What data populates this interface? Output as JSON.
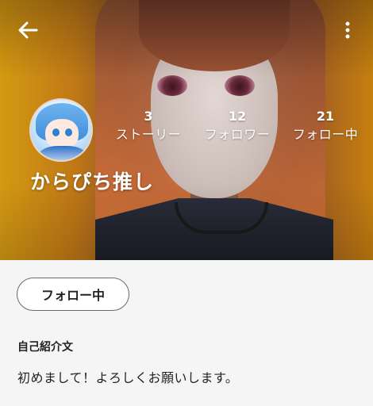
{
  "header": {
    "back_icon": "arrow-left-icon",
    "menu_icon": "more-vertical-icon"
  },
  "profile": {
    "name": "からぴち推し",
    "stats": [
      {
        "count": "3",
        "label": "ストーリー"
      },
      {
        "count": "12",
        "label": "フォロワー"
      },
      {
        "count": "21",
        "label": "フォロー中"
      }
    ]
  },
  "actions": {
    "follow_label": "フォロー中"
  },
  "bio": {
    "heading": "自己紹介文",
    "text": "初めまして！よろしくお願いします。"
  },
  "colors": {
    "background": "#f5f5f5",
    "hero_accent": "#d49a12",
    "text": "#222222"
  }
}
